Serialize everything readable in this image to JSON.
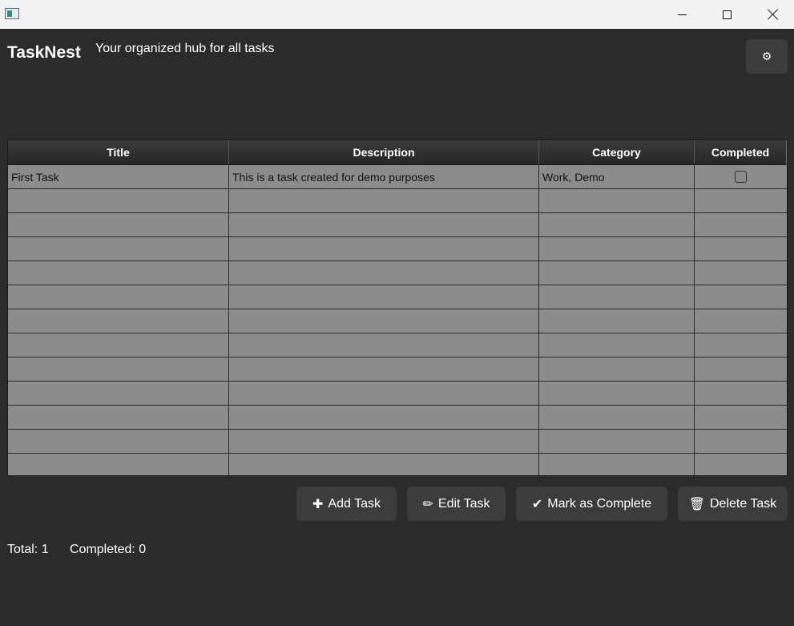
{
  "window": {
    "icon": "app-window-icon",
    "controls": [
      "minimize-icon",
      "maximize-icon",
      "close-icon"
    ]
  },
  "header": {
    "title": "TaskNest",
    "subtitle": "Your organized hub for all tasks",
    "settings_icon": "⚙"
  },
  "table": {
    "columns": [
      "Title",
      "Description",
      "Category",
      "Completed"
    ],
    "rows": [
      {
        "title": "First Task",
        "description": "This is a task created for demo purposes",
        "category": "Work, Demo",
        "completed": false
      }
    ],
    "empty_rows": 12
  },
  "actions": {
    "add": {
      "icon": "✚",
      "label": "Add Task"
    },
    "edit": {
      "icon": "✏",
      "label": "Edit Task"
    },
    "complete": {
      "icon": "✔",
      "label": "Mark as Complete"
    },
    "delete": {
      "icon": "🗑",
      "label": "Delete Task"
    }
  },
  "stats": {
    "total": "Total: 1",
    "completed": "Completed: 0"
  },
  "colors": {
    "background": "#2b2b2b",
    "button": "#3c3c3c",
    "table_row": "#8c8c8c",
    "titlebar": "#f3f3f3"
  }
}
